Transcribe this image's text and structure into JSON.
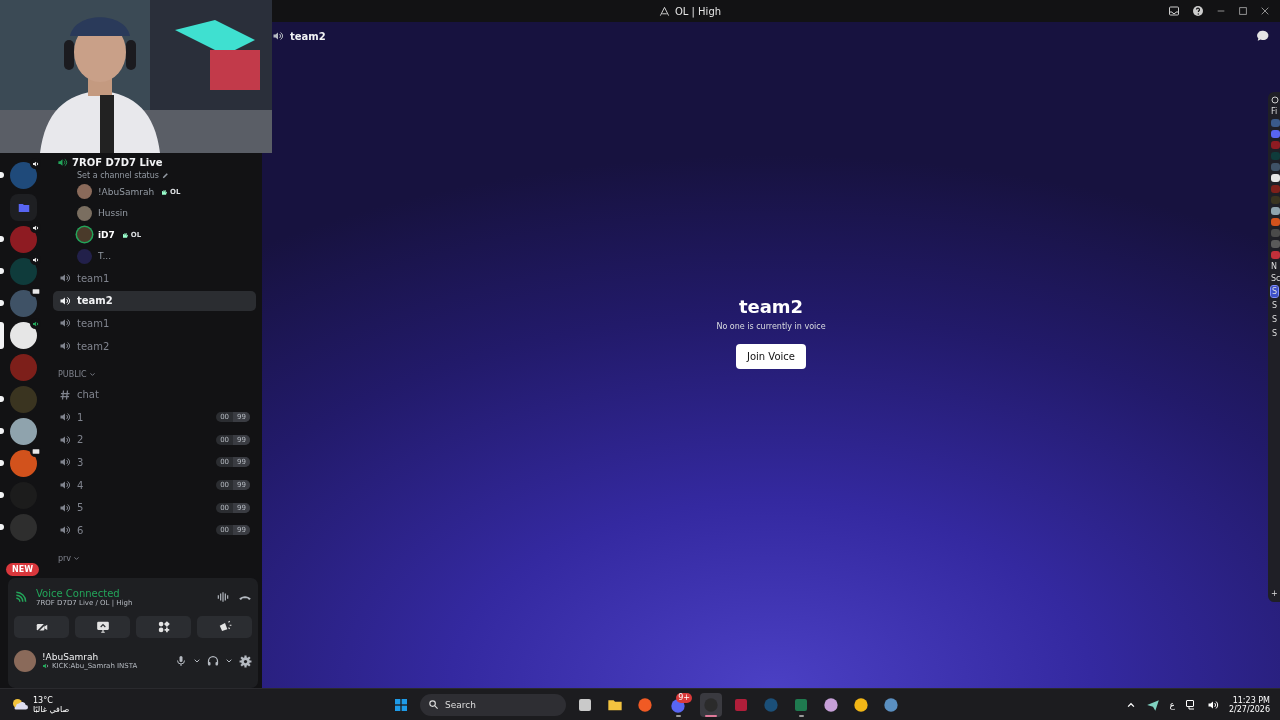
{
  "window": {
    "title": "OL | High"
  },
  "servers": [
    {
      "color": "#1f4a7a",
      "unread": true,
      "selected": false,
      "voice": true,
      "screen": false
    },
    {
      "color": "#5865f2",
      "unread": false,
      "selected": false,
      "voice": false,
      "screen": false,
      "kind": "folder"
    },
    {
      "color": "#8e1b22",
      "unread": true,
      "selected": false,
      "voice": true,
      "screen": false
    },
    {
      "color": "#0f3b3b",
      "unread": true,
      "selected": false,
      "voice": true,
      "screen": false
    },
    {
      "color": "#3f5266",
      "unread": true,
      "selected": false,
      "voice": false,
      "screen": true
    },
    {
      "color": "#e6e6e6",
      "unread": false,
      "selected": true,
      "voice": true,
      "screen": false,
      "connected": true
    },
    {
      "color": "#7d1f1a",
      "unread": false,
      "selected": false,
      "voice": false,
      "screen": false
    },
    {
      "color": "#3a3420",
      "unread": true,
      "selected": false,
      "voice": false,
      "screen": false
    },
    {
      "color": "#8fa3ad",
      "unread": true,
      "selected": false,
      "voice": false,
      "screen": false
    },
    {
      "color": "#d2521c",
      "unread": true,
      "selected": false,
      "voice": false,
      "screen": true
    },
    {
      "color": "#1c1c1c",
      "unread": true,
      "selected": false,
      "voice": false,
      "screen": false
    },
    {
      "color": "#2e2e2e",
      "unread": true,
      "selected": false,
      "voice": false,
      "screen": false
    }
  ],
  "new_badge": "NEW",
  "live_channel": {
    "name": "7ROF D7D7 Live",
    "status": "Set a channel status",
    "members": [
      {
        "name": "!AbuSamrah",
        "tag": "OL",
        "speaking": false,
        "color": "#8a6a5a"
      },
      {
        "name": "Hussin",
        "speaking": false,
        "color": "#7a6e60"
      },
      {
        "name": "iD7",
        "tag": "OL",
        "speaking": true,
        "color": "#4a3a2a"
      },
      {
        "name": "T...",
        "speaking": false,
        "color": "#22204a"
      }
    ]
  },
  "channels": [
    {
      "name": "team1",
      "kind": "voice",
      "selected": false
    },
    {
      "name": "team2",
      "kind": "voice",
      "selected": true
    },
    {
      "name": "team1",
      "kind": "voice",
      "selected": false
    },
    {
      "name": "team2",
      "kind": "voice",
      "selected": false
    }
  ],
  "categories": [
    {
      "name": "PUBLIC",
      "channels": [
        {
          "name": "chat",
          "kind": "text",
          "selected": false
        },
        {
          "name": "1",
          "kind": "voice",
          "selected": false,
          "count": "00",
          "limit": "99"
        },
        {
          "name": "2",
          "kind": "voice",
          "selected": false,
          "count": "00",
          "limit": "99"
        },
        {
          "name": "3",
          "kind": "voice",
          "selected": false,
          "count": "00",
          "limit": "99"
        },
        {
          "name": "4",
          "kind": "voice",
          "selected": false,
          "count": "00",
          "limit": "99"
        },
        {
          "name": "5",
          "kind": "voice",
          "selected": false,
          "count": "00",
          "limit": "99"
        },
        {
          "name": "6",
          "kind": "voice",
          "selected": false,
          "count": "00",
          "limit": "99"
        }
      ]
    },
    {
      "name": "prv"
    }
  ],
  "voice_panel": {
    "status": "Voice Connected",
    "location": "7ROF D7D7 Live / OL | High"
  },
  "user": {
    "name": "!AbuSamrah",
    "status": "KICK:Abu_Samrah INSTA"
  },
  "main": {
    "channel": "team2",
    "title": "team2",
    "message": "No one is currently in voice",
    "button": "Join Voice"
  },
  "side_panel": {
    "heading": "Fi",
    "label": "N",
    "section": "Sc",
    "add": "+",
    "scenes": [
      {
        "label": "S",
        "selected": true
      },
      {
        "label": "S",
        "selected": false
      },
      {
        "label": "S",
        "selected": false
      },
      {
        "label": "S",
        "selected": false
      }
    ]
  },
  "taskbar": {
    "temperature": "13°C",
    "weather": "صافي غالبًا",
    "search": "Search",
    "apps": [
      {
        "kind": "windows",
        "color": "#1e9be8",
        "running": false
      },
      {
        "kind": "tile",
        "color": "#c9c9c9",
        "running": false
      },
      {
        "kind": "folder",
        "color": "#f3c33f",
        "running": false
      },
      {
        "kind": "circle",
        "color": "#f05a24",
        "running": false
      },
      {
        "kind": "circle",
        "color": "#5865f2",
        "running": true,
        "badge": "9+"
      },
      {
        "kind": "circle",
        "color": "#2b2b2b",
        "running": true,
        "active": true
      },
      {
        "kind": "tile",
        "color": "#b01e3a",
        "running": false
      },
      {
        "kind": "circle",
        "color": "#1b4f78",
        "running": false
      },
      {
        "kind": "tile",
        "color": "#1f7a4f",
        "running": true
      },
      {
        "kind": "circle",
        "color": "#c7a0d8",
        "running": false
      },
      {
        "kind": "circle",
        "color": "#f2b616",
        "running": false
      },
      {
        "kind": "circle",
        "color": "#5a8fc0",
        "running": false
      }
    ],
    "language": "ع",
    "time": "11:23 PM",
    "date": "2/27/2026"
  }
}
